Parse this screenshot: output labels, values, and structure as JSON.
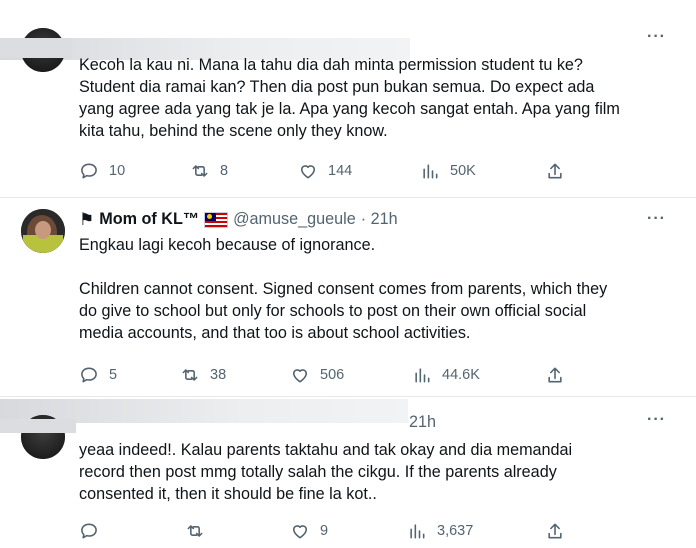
{
  "tweets": [
    {
      "text": "Kecoh la kau ni. Mana la tahu dia dah minta permission student tu ke?\nStudent dia ramai kan? Then dia post pun bukan semua. Do expect ada\nyang agree ada yang tak je la. Apa yang kecoh sangat entah. Apa yang film\nkita tahu, behind the scene only they know.",
      "replies": "10",
      "retweets": "8",
      "likes": "144",
      "views": "50K"
    },
    {
      "name": "Mom of KL™",
      "flag_icon": "black-flag-icon",
      "country_flag": "malaysia-flag-icon",
      "handle": "@amuse_gueule",
      "time": "· 21h",
      "text": "Engkau lagi kecoh because of ignorance.\n\nChildren cannot consent. Signed consent comes from parents, which they\ndo give to school but only for schools to post on their own official social\nmedia accounts, and that too is about school activities.",
      "replies": "5",
      "retweets": "38",
      "likes": "506",
      "views": "44.6K"
    },
    {
      "time": "21h",
      "text": "yeaa indeed!. Kalau parents taktahu and tak okay and dia memandai\nrecord then post mmg totally salah the cikgu. If the parents already\nconsented it, then it should be fine la kot..",
      "replies": "",
      "retweets": "",
      "likes": "9",
      "views": "3,637"
    }
  ],
  "more_label": "···",
  "colors": {
    "muted": "#536471",
    "text": "#0f1419",
    "divider": "#e6e9ec"
  }
}
